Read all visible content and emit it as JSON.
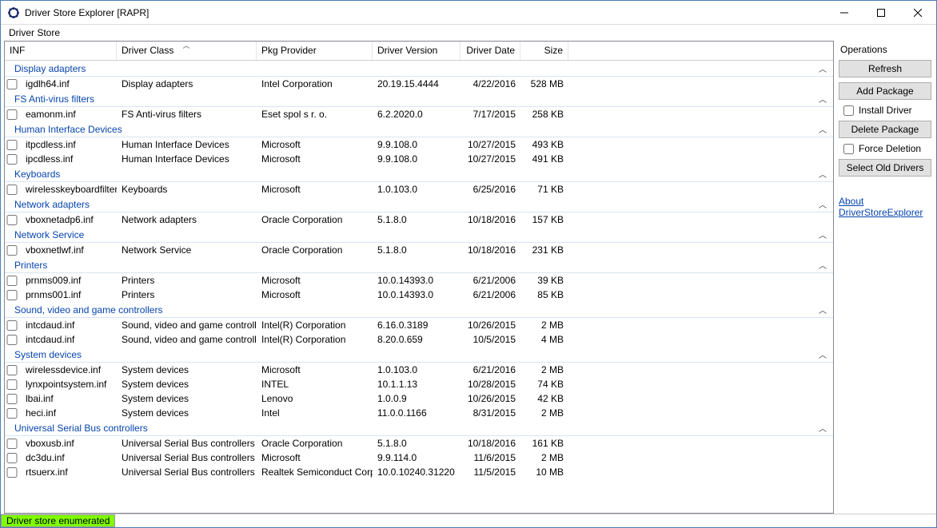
{
  "window": {
    "title": "Driver Store Explorer [RAPR]"
  },
  "menu": {
    "driver_store": "Driver Store"
  },
  "columns": {
    "inf": "INF",
    "class": "Driver Class",
    "provider": "Pkg Provider",
    "version": "Driver Version",
    "date": "Driver Date",
    "size": "Size"
  },
  "groups": [
    {
      "name": "Display adapters",
      "rows": [
        {
          "inf": "igdlh64.inf",
          "class": "Display adapters",
          "provider": "Intel Corporation",
          "version": "20.19.15.4444",
          "date": "4/22/2016",
          "size": "528 MB"
        }
      ]
    },
    {
      "name": "FS Anti-virus filters",
      "rows": [
        {
          "inf": "eamonm.inf",
          "class": "FS Anti-virus filters",
          "provider": "Eset spol s r. o.",
          "version": "6.2.2020.0",
          "date": "7/17/2015",
          "size": "258 KB"
        }
      ]
    },
    {
      "name": "Human Interface Devices",
      "rows": [
        {
          "inf": "itpcdless.inf",
          "class": "Human Interface Devices",
          "provider": "Microsoft",
          "version": "9.9.108.0",
          "date": "10/27/2015",
          "size": "493 KB"
        },
        {
          "inf": "ipcdless.inf",
          "class": "Human Interface Devices",
          "provider": "Microsoft",
          "version": "9.9.108.0",
          "date": "10/27/2015",
          "size": "491 KB"
        }
      ]
    },
    {
      "name": "Keyboards",
      "rows": [
        {
          "inf": "wirelesskeyboardfilter.inf",
          "class": "Keyboards",
          "provider": "Microsoft",
          "version": "1.0.103.0",
          "date": "6/25/2016",
          "size": "71 KB"
        }
      ]
    },
    {
      "name": "Network adapters",
      "rows": [
        {
          "inf": "vboxnetadp6.inf",
          "class": "Network adapters",
          "provider": "Oracle Corporation",
          "version": "5.1.8.0",
          "date": "10/18/2016",
          "size": "157 KB"
        }
      ]
    },
    {
      "name": "Network Service",
      "rows": [
        {
          "inf": "vboxnetlwf.inf",
          "class": "Network Service",
          "provider": "Oracle Corporation",
          "version": "5.1.8.0",
          "date": "10/18/2016",
          "size": "231 KB"
        }
      ]
    },
    {
      "name": "Printers",
      "rows": [
        {
          "inf": "prnms009.inf",
          "class": "Printers",
          "provider": "Microsoft",
          "version": "10.0.14393.0",
          "date": "6/21/2006",
          "size": "39 KB"
        },
        {
          "inf": "prnms001.inf",
          "class": "Printers",
          "provider": "Microsoft",
          "version": "10.0.14393.0",
          "date": "6/21/2006",
          "size": "85 KB"
        }
      ]
    },
    {
      "name": "Sound, video and game controllers",
      "rows": [
        {
          "inf": "intcdaud.inf",
          "class": "Sound, video and game controllers",
          "provider": "Intel(R) Corporation",
          "version": "6.16.0.3189",
          "date": "10/26/2015",
          "size": "2 MB"
        },
        {
          "inf": "intcdaud.inf",
          "class": "Sound, video and game controllers",
          "provider": "Intel(R) Corporation",
          "version": "8.20.0.659",
          "date": "10/5/2015",
          "size": "4 MB"
        }
      ]
    },
    {
      "name": "System devices",
      "rows": [
        {
          "inf": "wirelessdevice.inf",
          "class": "System devices",
          "provider": "Microsoft",
          "version": "1.0.103.0",
          "date": "6/21/2016",
          "size": "2 MB"
        },
        {
          "inf": "lynxpointsystem.inf",
          "class": "System devices",
          "provider": "INTEL",
          "version": "10.1.1.13",
          "date": "10/28/2015",
          "size": "74 KB"
        },
        {
          "inf": "lbai.inf",
          "class": "System devices",
          "provider": "Lenovo",
          "version": "1.0.0.9",
          "date": "10/26/2015",
          "size": "42 KB"
        },
        {
          "inf": "heci.inf",
          "class": "System devices",
          "provider": "Intel",
          "version": "11.0.0.1166",
          "date": "8/31/2015",
          "size": "2 MB"
        }
      ]
    },
    {
      "name": "Universal Serial Bus controllers",
      "rows": [
        {
          "inf": "vboxusb.inf",
          "class": "Universal Serial Bus controllers",
          "provider": "Oracle Corporation",
          "version": "5.1.8.0",
          "date": "10/18/2016",
          "size": "161 KB"
        },
        {
          "inf": "dc3du.inf",
          "class": "Universal Serial Bus controllers",
          "provider": "Microsoft",
          "version": "9.9.114.0",
          "date": "11/6/2015",
          "size": "2 MB"
        },
        {
          "inf": "rtsuerx.inf",
          "class": "Universal Serial Bus controllers",
          "provider": "Realtek Semiconduct Corp.",
          "version": "10.0.10240.31220",
          "date": "11/5/2015",
          "size": "10 MB"
        }
      ]
    }
  ],
  "operations": {
    "label": "Operations",
    "refresh": "Refresh",
    "add_package": "Add Package",
    "install_driver": "Install Driver",
    "delete_package": "Delete Package",
    "force_deletion": "Force Deletion",
    "select_old": "Select Old Drivers",
    "about": "About DriverStoreExplorer"
  },
  "status": {
    "text": "Driver store enumerated"
  }
}
